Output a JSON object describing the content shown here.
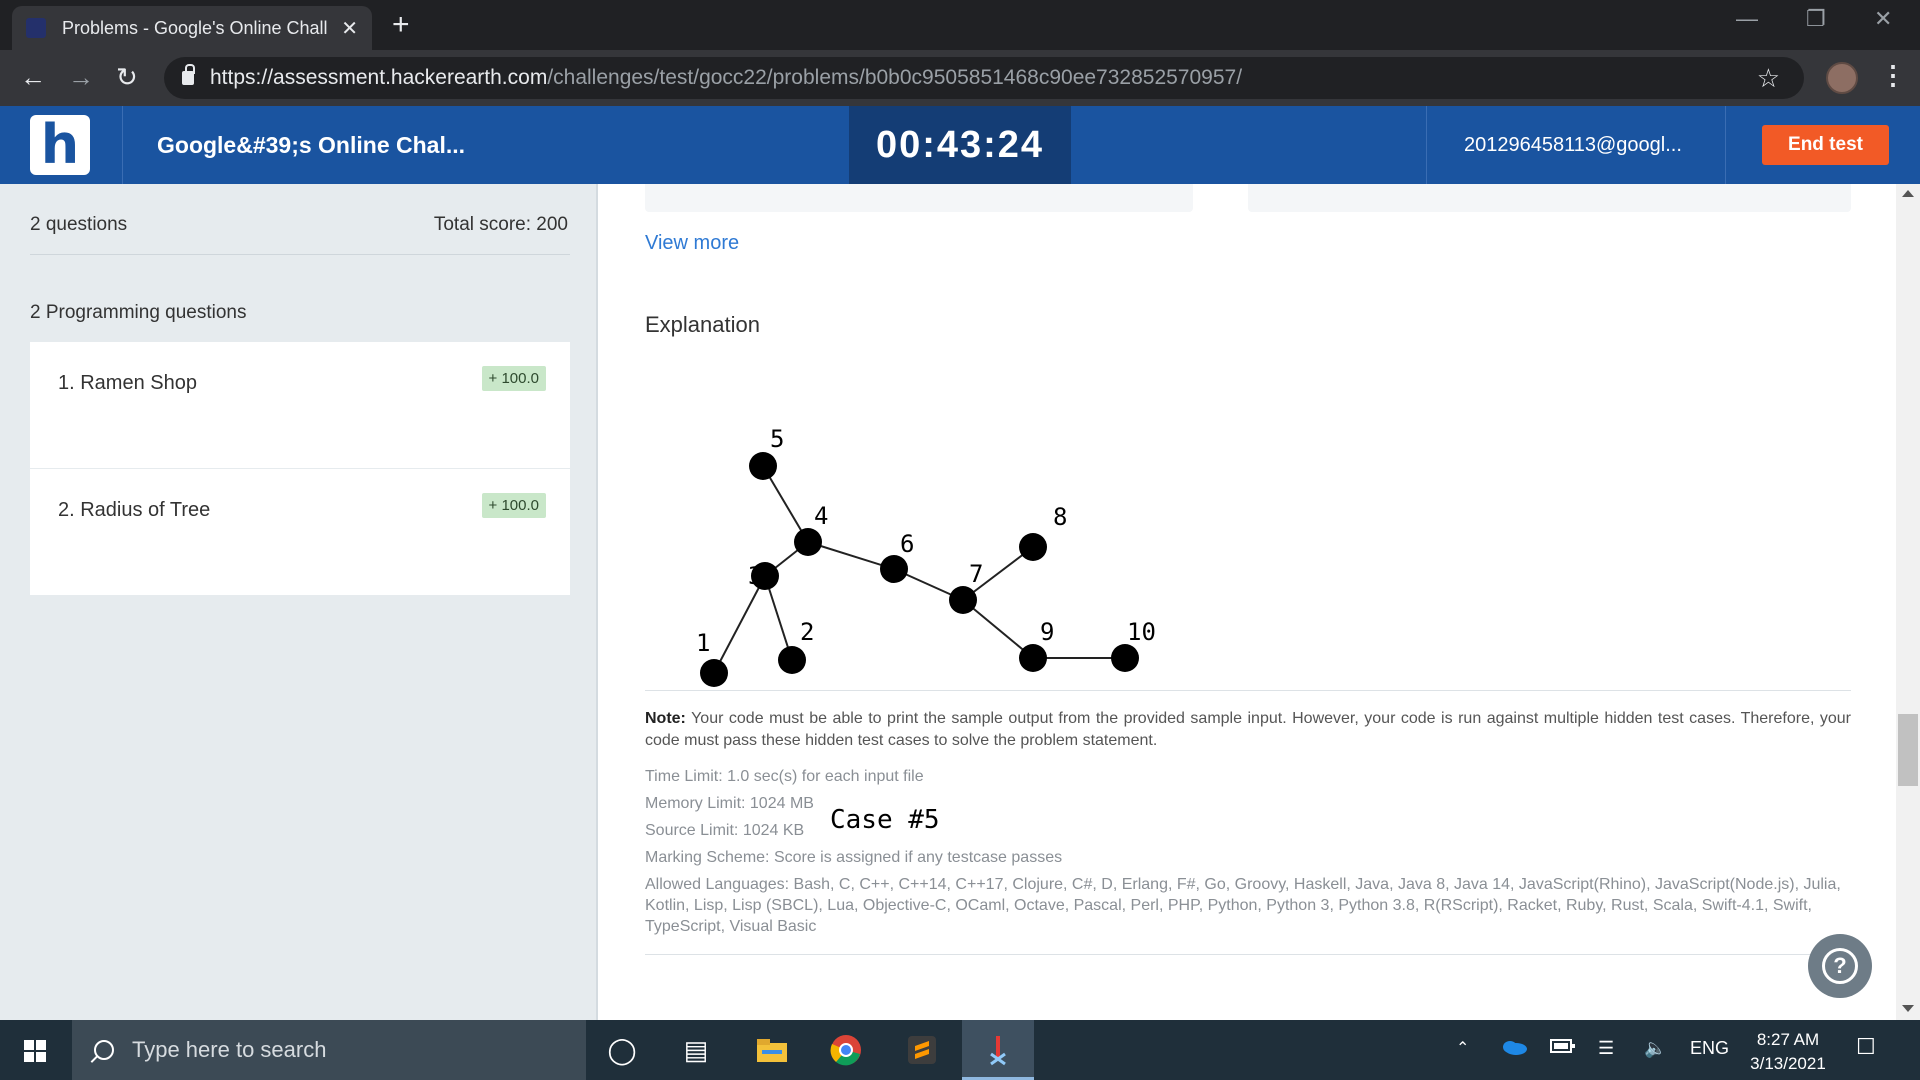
{
  "browser": {
    "tab_title": "Problems - Google's Online Chall",
    "tab_close": "✕",
    "new_tab": "+",
    "url_host": "https://assessment.hackerearth.com",
    "url_path": "/challenges/test/gocc22/problems/b0b0c9505851468c90ee732852570957/"
  },
  "header": {
    "logo_letter": "h",
    "title": "Google&#39;s Online Chal...",
    "timer": "00:43:24",
    "user": "201296458113@googl...",
    "end_test": "End test"
  },
  "sidebar": {
    "question_count": "2 questions",
    "total_score": "Total score: 200",
    "section_label": "2 Programming questions",
    "questions": [
      {
        "label": "1.  Ramen Shop",
        "score": "+ 100.0"
      },
      {
        "label": "2.  Radius of Tree",
        "score": "+ 100.0"
      }
    ]
  },
  "main": {
    "view_more": "View more",
    "explanation_title": "Explanation",
    "graph_caption": "Case #5",
    "graph_nodes": [
      "1",
      "2",
      "3",
      "4",
      "5",
      "6",
      "7",
      "8",
      "9",
      "10"
    ],
    "note_label": "Note:",
    "note_text": "Your code must be able to print the sample output from the provided sample input. However, your code is run against multiple hidden test cases. Therefore, your code must pass these hidden test cases to solve the problem statement.",
    "time_limit": "Time Limit: 1.0 sec(s) for each input file",
    "memory_limit": "Memory Limit: 1024 MB",
    "source_limit": "Source Limit: 1024 KB",
    "marking_scheme": "Marking Scheme: Score is assigned if any testcase passes",
    "allowed_languages": "Allowed Languages: Bash, C, C++, C++14, C++17, Clojure, C#, D, Erlang, F#, Go, Groovy, Haskell, Java, Java 8, Java 14, JavaScript(Rhino), JavaScript(Node.js), Julia, Kotlin, Lisp, Lisp (SBCL), Lua, Objective-C, OCaml, Octave, Pascal, Perl, PHP, Python, Python 3, Python 3.8, R(RScript), Racket, Ruby, Rust, Scala, Swift-4.1, Swift, TypeScript, Visual Basic",
    "help": "?"
  },
  "taskbar": {
    "search_placeholder": "Type here to search",
    "language": "ENG",
    "time": "8:27 AM",
    "date": "3/13/2021"
  },
  "colors": {
    "header_blue": "#1a54a0",
    "timer_bg": "#143d75",
    "end_test_orange": "#f25a26",
    "link_blue": "#2f7ad4",
    "score_badge": "#c9e7c9"
  }
}
